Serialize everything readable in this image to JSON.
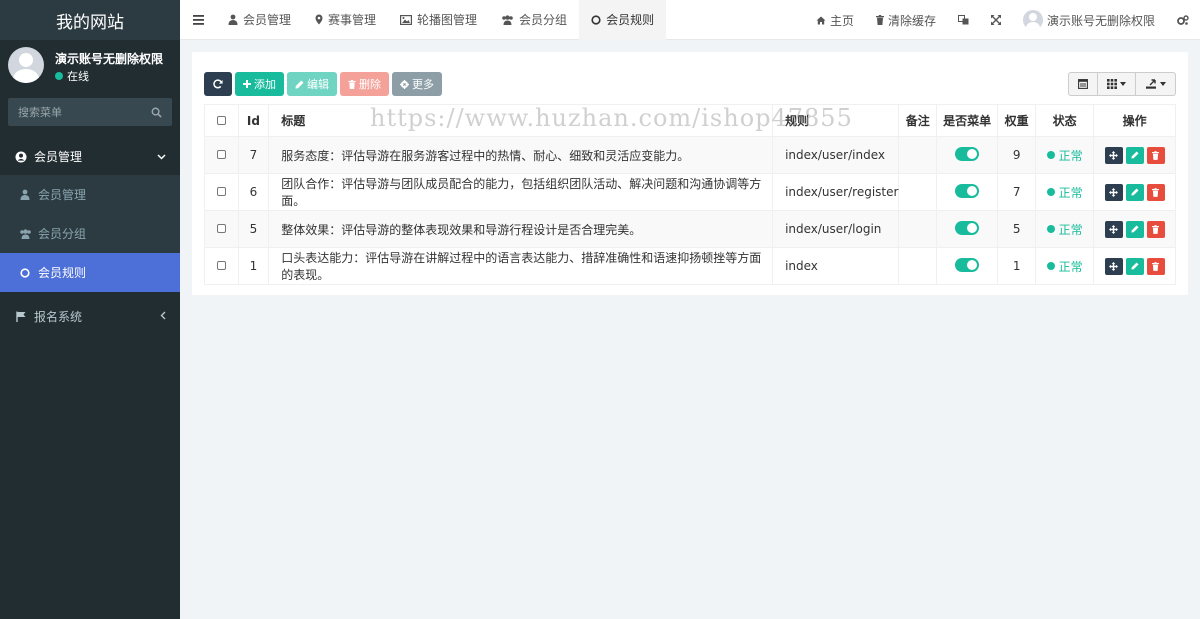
{
  "sidebar": {
    "logo": "我的网站",
    "user_name": "演示账号无删除权限",
    "user_status": "在线",
    "search_placeholder": "搜索菜单",
    "menu": [
      {
        "label": "会员管理",
        "icon": "user-circle-icon"
      },
      {
        "label": "会员管理",
        "icon": "user-icon"
      },
      {
        "label": "会员分组",
        "icon": "users-icon"
      },
      {
        "label": "会员规则",
        "icon": "circle-icon"
      },
      {
        "label": "报名系统",
        "icon": "flag-icon"
      }
    ]
  },
  "topnav": {
    "tabs": [
      {
        "label": "会员管理"
      },
      {
        "label": "赛事管理"
      },
      {
        "label": "轮播图管理"
      },
      {
        "label": "会员分组"
      },
      {
        "label": "会员规则"
      }
    ],
    "home": "主页",
    "clear_cache": "清除缓存",
    "account": "演示账号无删除权限"
  },
  "toolbar": {
    "add": "添加",
    "edit": "编辑",
    "delete": "删除",
    "more": "更多"
  },
  "table": {
    "headers": {
      "id": "Id",
      "title": "标题",
      "rule": "规则",
      "remark": "备注",
      "is_menu": "是否菜单",
      "weight": "权重",
      "status": "状态",
      "actions": "操作"
    },
    "rows": [
      {
        "id": "7",
        "title": "服务态度：评估导游在服务游客过程中的热情、耐心、细致和灵活应变能力。",
        "rule": "index/user/index",
        "remark": "",
        "is_menu": true,
        "weight": "9",
        "status": "正常"
      },
      {
        "id": "6",
        "title": "团队合作：评估导游与团队成员配合的能力，包括组织团队活动、解决问题和沟通协调等方面。",
        "rule": "index/user/register",
        "remark": "",
        "is_menu": true,
        "weight": "7",
        "status": "正常"
      },
      {
        "id": "5",
        "title": "整体效果：评估导游的整体表现效果和导游行程设计是否合理完美。",
        "rule": "index/user/login",
        "remark": "",
        "is_menu": true,
        "weight": "5",
        "status": "正常"
      },
      {
        "id": "1",
        "title": "口头表达能力：评估导游在讲解过程中的语言表达能力、措辞准确性和语速抑扬顿挫等方面的表现。",
        "rule": "index",
        "remark": "",
        "is_menu": true,
        "weight": "1",
        "status": "正常"
      }
    ]
  },
  "watermark": "https://www.huzhan.com/ishop47855",
  "colors": {
    "accent": "#18bc9c",
    "sidebar": "#222d32",
    "active": "#4d6fd8",
    "danger": "#e74c3c"
  }
}
